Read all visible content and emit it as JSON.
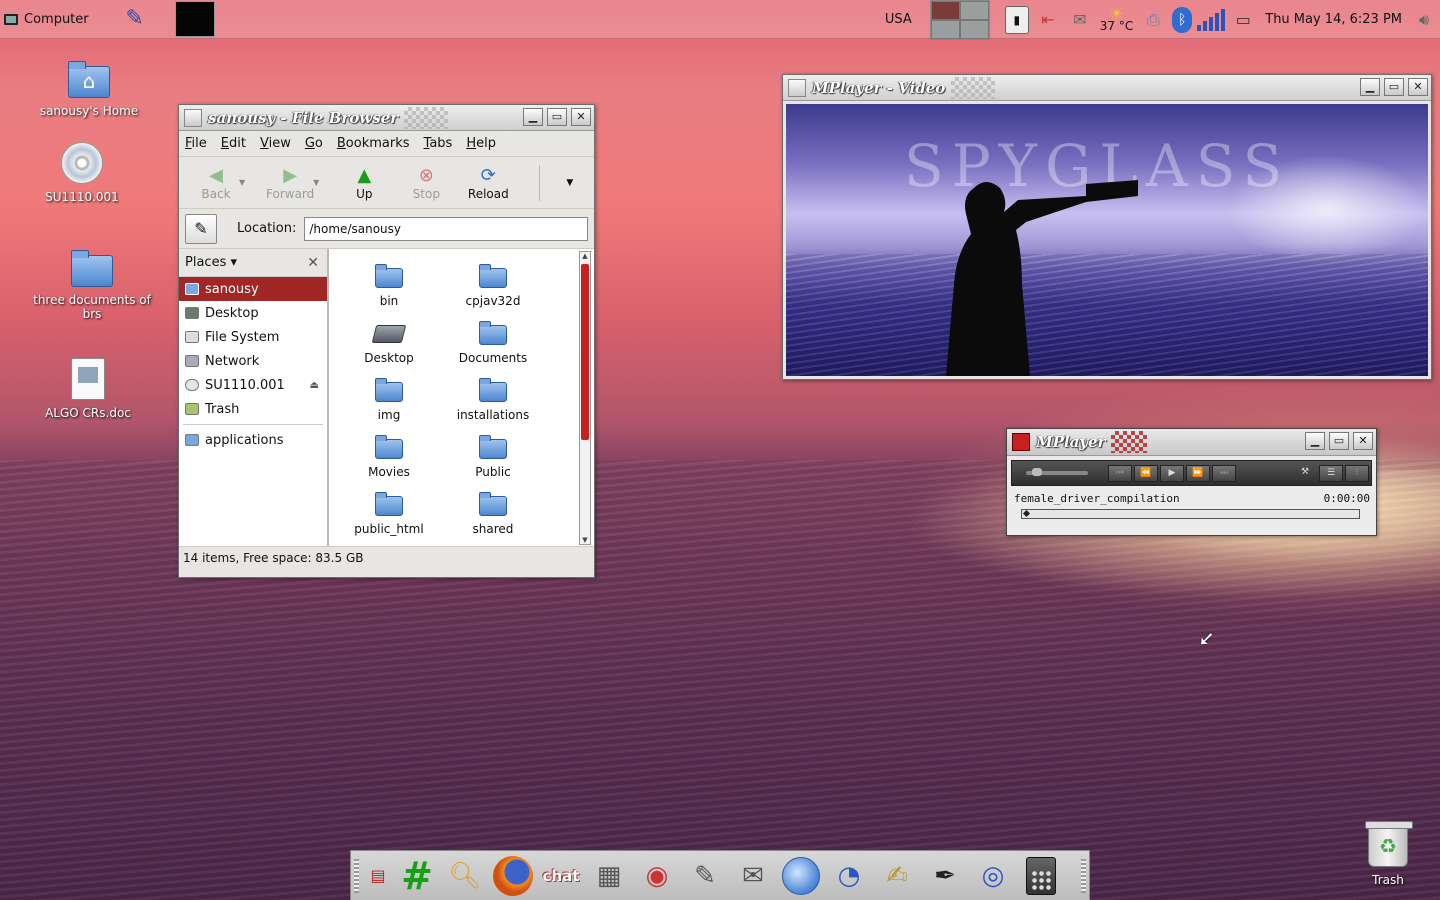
{
  "top_panel": {
    "computer_label": "Computer",
    "keyboard_layout": "USA",
    "weather_temp": "37 °C",
    "clock": "Thu May 14,  6:23 PM"
  },
  "desktop_icons": [
    {
      "label": "sanousy's Home",
      "icon": "home-folder-icon"
    },
    {
      "label": "SU1110.001",
      "icon": "cd-icon"
    },
    {
      "label": "three documents of brs",
      "icon": "folder-icon"
    },
    {
      "label": "ALGO CRs.doc",
      "icon": "document-icon"
    },
    {
      "label": "Trash",
      "icon": "trash-icon"
    }
  ],
  "file_browser": {
    "title": "sanousy - File Browser",
    "menu": [
      "File",
      "Edit",
      "View",
      "Go",
      "Bookmarks",
      "Tabs",
      "Help"
    ],
    "toolbar": {
      "back": "Back",
      "forward": "Forward",
      "up": "Up",
      "stop": "Stop",
      "reload": "Reload"
    },
    "location_label": "Location:",
    "location_value": "/home/sanousy",
    "places_label": "Places",
    "places": [
      {
        "label": "sanousy",
        "selected": true
      },
      {
        "label": "Desktop",
        "selected": false
      },
      {
        "label": "File System",
        "selected": false
      },
      {
        "label": "Network",
        "selected": false
      },
      {
        "label": "SU1110.001",
        "selected": false
      },
      {
        "label": "Trash",
        "selected": false
      }
    ],
    "bookmarks": [
      "applications"
    ],
    "items": [
      "bin",
      "cpjav32d",
      "Desktop",
      "Documents",
      "img",
      "installations",
      "Movies",
      "Public",
      "public_html",
      "shared"
    ],
    "status": "14 items, Free space: 83.5 GB"
  },
  "mplayer_video": {
    "title": "MPlayer - Video",
    "overlay_text": "SPYGLASS"
  },
  "mplayer_control": {
    "title": "MPlayer",
    "file_name": "female_driver_compilation",
    "time": "0:00:00",
    "progress": 0
  }
}
